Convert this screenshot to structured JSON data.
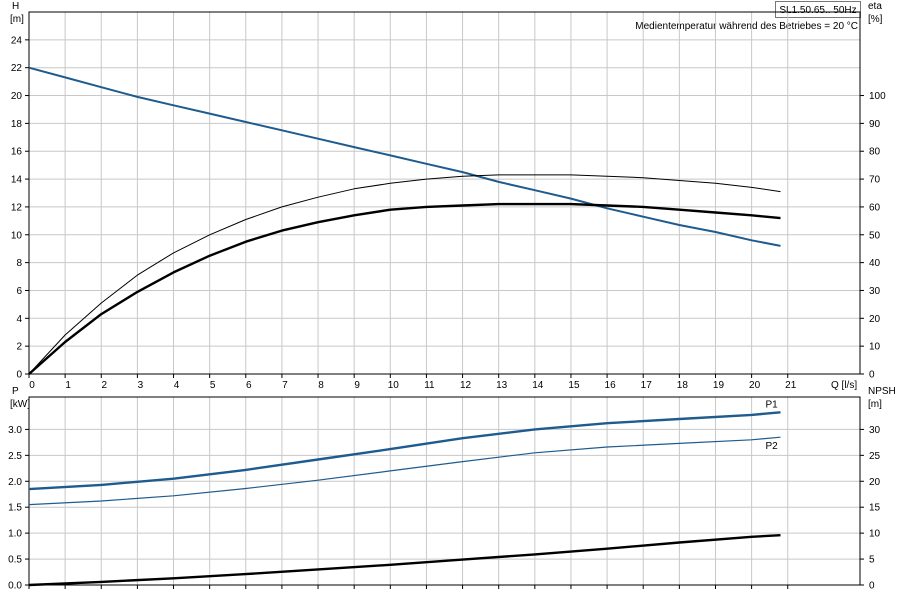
{
  "header": {
    "model": "SL1.50.65.. 50Hz",
    "medium_note": "Medientemperatur während des Betriebes = 20 °C"
  },
  "chart_data": [
    {
      "type": "line",
      "ylabel_left": [
        "H",
        "[m]"
      ],
      "ylabel_right": [
        "eta",
        "[%]"
      ],
      "xlabel": "Q [l/s]",
      "xlim": [
        0,
        23
      ],
      "x_ticks": [
        0,
        1,
        2,
        3,
        4,
        5,
        6,
        7,
        8,
        9,
        10,
        11,
        12,
        13,
        14,
        15,
        16,
        17,
        18,
        19,
        20,
        21
      ],
      "ylim_left": [
        0,
        26
      ],
      "y_ticks_left": [
        0,
        2,
        4,
        6,
        8,
        10,
        12,
        14,
        16,
        18,
        20,
        22,
        24
      ],
      "ylim_right": [
        0,
        130
      ],
      "y_ticks_right": [
        0,
        10,
        20,
        30,
        40,
        50,
        60,
        70,
        80,
        90,
        100
      ],
      "grid": true,
      "series": [
        {
          "axis": "left",
          "color": "#1f5b8e",
          "width": 2,
          "x": [
            0,
            1,
            2,
            3,
            4,
            5,
            6,
            7,
            8,
            9,
            10,
            11,
            12,
            13,
            14,
            15,
            16,
            17,
            18,
            19,
            20,
            20.8
          ],
          "y": [
            22.0,
            21.3,
            20.6,
            19.9,
            19.3,
            18.7,
            18.1,
            17.5,
            16.9,
            16.3,
            15.7,
            15.1,
            14.5,
            13.8,
            13.2,
            12.6,
            11.9,
            11.3,
            10.7,
            10.2,
            9.6,
            9.2
          ]
        },
        {
          "axis": "left",
          "color": "#000000",
          "width": 1,
          "x": [
            0,
            1,
            2,
            3,
            4,
            5,
            6,
            7,
            8,
            9,
            10,
            11,
            12,
            13,
            14,
            15,
            16,
            17,
            18,
            19,
            20,
            20.8
          ],
          "y": [
            0,
            2.8,
            5.1,
            7.1,
            8.7,
            10.0,
            11.1,
            12.0,
            12.7,
            13.3,
            13.7,
            14.0,
            14.2,
            14.3,
            14.3,
            14.3,
            14.2,
            14.1,
            13.9,
            13.7,
            13.4,
            13.1
          ]
        },
        {
          "axis": "left",
          "color": "#000000",
          "width": 2.4,
          "x": [
            0,
            1,
            2,
            3,
            4,
            5,
            6,
            7,
            8,
            9,
            10,
            11,
            12,
            13,
            14,
            15,
            16,
            17,
            18,
            19,
            20,
            20.8
          ],
          "y": [
            0,
            2.3,
            4.3,
            5.9,
            7.3,
            8.5,
            9.5,
            10.3,
            10.9,
            11.4,
            11.8,
            12.0,
            12.1,
            12.2,
            12.2,
            12.2,
            12.1,
            12.0,
            11.8,
            11.6,
            11.4,
            11.2
          ]
        }
      ]
    },
    {
      "type": "line",
      "ylabel_left": [
        "P",
        "[kW]"
      ],
      "ylabel_right": [
        "NPSH",
        "[m]"
      ],
      "xlim": [
        0,
        23
      ],
      "ylim_left": [
        0,
        3.625
      ],
      "y_ticks_left": [
        "0.0",
        "0.5",
        "1.0",
        "1.5",
        "2.0",
        "2.5",
        "3.0"
      ],
      "ylim_right": [
        0,
        36.25
      ],
      "y_ticks_right": [
        0,
        5,
        10,
        15,
        20,
        25,
        30
      ],
      "grid": true,
      "series": [
        {
          "name": "P1",
          "axis": "left",
          "color": "#1f5b8e",
          "width": 2.4,
          "x": [
            0,
            2,
            4,
            6,
            8,
            10,
            12,
            14,
            16,
            18,
            20,
            20.8
          ],
          "y": [
            1.85,
            1.93,
            2.05,
            2.22,
            2.42,
            2.62,
            2.83,
            3.0,
            3.12,
            3.2,
            3.28,
            3.33
          ]
        },
        {
          "name": "P2",
          "axis": "left",
          "color": "#1f5b8e",
          "width": 1.2,
          "x": [
            0,
            2,
            4,
            6,
            8,
            10,
            12,
            14,
            16,
            18,
            20,
            20.8
          ],
          "y": [
            1.55,
            1.62,
            1.72,
            1.86,
            2.02,
            2.2,
            2.38,
            2.55,
            2.66,
            2.73,
            2.8,
            2.85
          ]
        },
        {
          "axis": "right",
          "color": "#000000",
          "width": 2.4,
          "x": [
            0,
            2,
            4,
            6,
            8,
            10,
            12,
            14,
            16,
            18,
            20,
            20.8
          ],
          "y": [
            0,
            0.6,
            1.3,
            2.1,
            3.0,
            3.9,
            4.9,
            5.9,
            7.0,
            8.2,
            9.3,
            9.6
          ]
        }
      ]
    }
  ]
}
